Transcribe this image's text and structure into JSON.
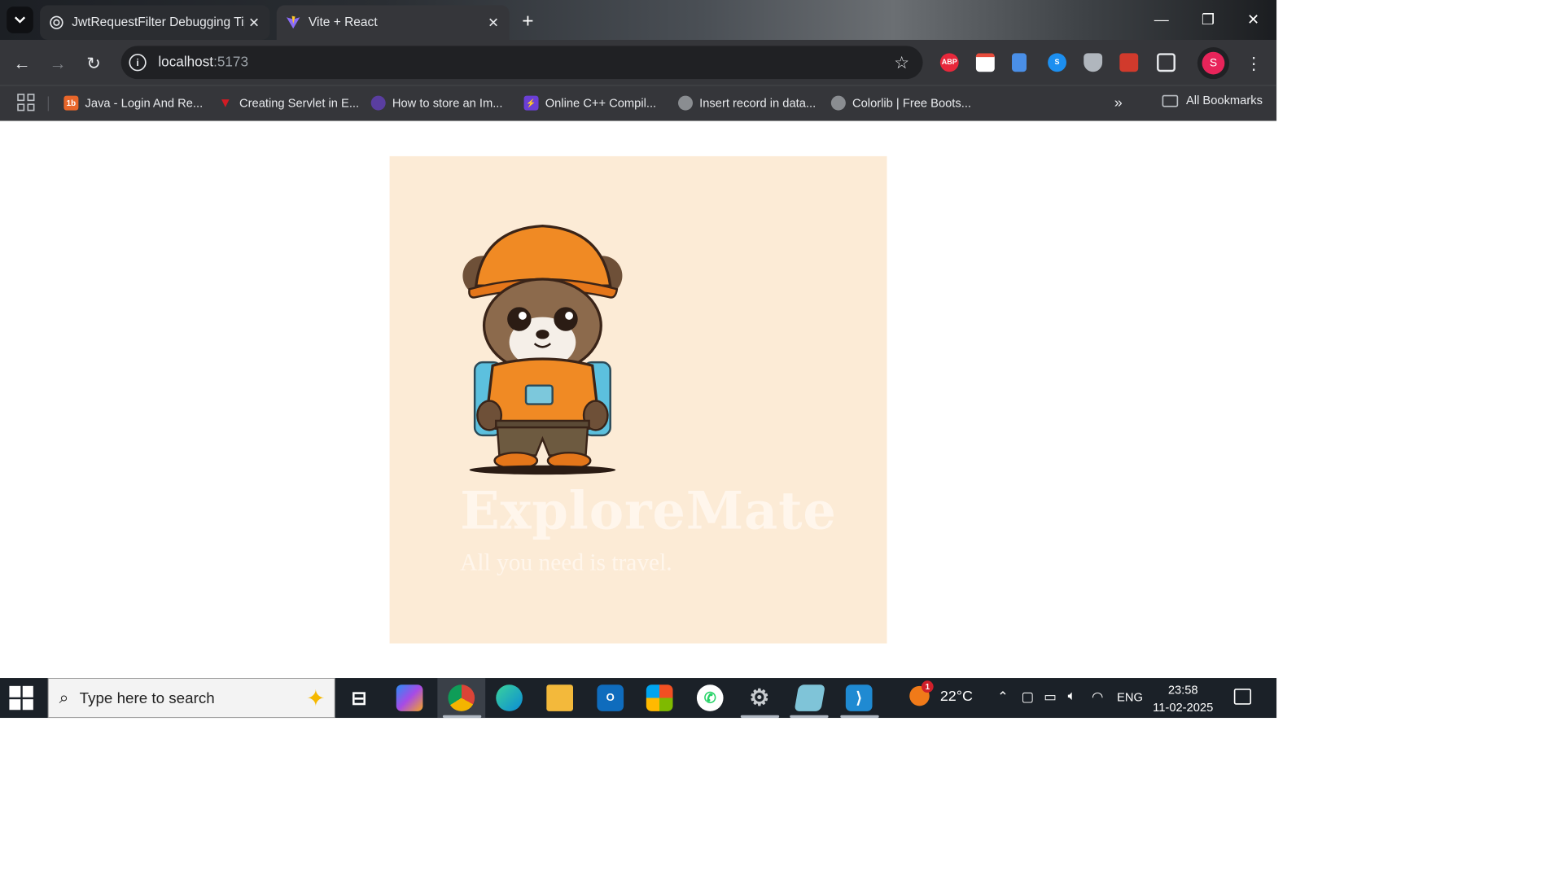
{
  "tabs": [
    {
      "title": "JwtRequestFilter Debugging Tip",
      "icon": "openai-icon",
      "active": false
    },
    {
      "title": "Vite + React",
      "icon": "vite-icon",
      "active": true
    }
  ],
  "address_bar": {
    "host": "localhost",
    "port": ":5173"
  },
  "extensions": [
    {
      "name": "adblock-plus-icon",
      "label": "ABP",
      "color": "#e8283b"
    },
    {
      "name": "calendar-icon",
      "label": "",
      "color": "#ffffff"
    },
    {
      "name": "docs-icon",
      "label": "",
      "color": "#4a8fe7"
    },
    {
      "name": "shazam-icon",
      "label": "",
      "color": "#1c8ff0"
    },
    {
      "name": "shield-icon",
      "label": "",
      "color": "#b0b6bd"
    },
    {
      "name": "puzzle-red-icon",
      "label": "",
      "color": "#d13a2c"
    }
  ],
  "profile_initial": "S",
  "bookmarks": [
    {
      "label": "Java - Login And Re...",
      "icon": "1b",
      "color": "#e8662a"
    },
    {
      "label": "Creating Servlet in E...",
      "icon": "V",
      "color": "#d11b24"
    },
    {
      "label": "How to store an Im...",
      "icon": "",
      "color": "#5a3ea0"
    },
    {
      "label": "Online C++ Compil...",
      "icon": "⚡",
      "color": "#6b3fd6"
    },
    {
      "label": "Insert record in data...",
      "icon": "",
      "color": "#8a8d91"
    },
    {
      "label": "Colorlib | Free Boots...",
      "icon": "",
      "color": "#8a8d91"
    }
  ],
  "all_bookmarks_label": "All Bookmarks",
  "page": {
    "brand_name": "ExploreMate",
    "tagline": "All you need is travel.",
    "background": "#fcebd6"
  },
  "taskbar": {
    "search_placeholder": "Type here to search",
    "apps": [
      {
        "name": "task-view-icon",
        "color": "transparent",
        "glyph": "⊟"
      },
      {
        "name": "copilot-icon",
        "color": "#7a5ce6",
        "glyph": ""
      },
      {
        "name": "chrome-icon",
        "color": "#db4437",
        "glyph": ""
      },
      {
        "name": "edge-icon",
        "color": "#0b8bd6",
        "glyph": ""
      },
      {
        "name": "file-explorer-icon",
        "color": "#f3b93b",
        "glyph": ""
      },
      {
        "name": "outlook-icon",
        "color": "#0f6cbd",
        "glyph": "O"
      },
      {
        "name": "store-icon",
        "color": "#2a7ad8",
        "glyph": ""
      },
      {
        "name": "whatsapp-icon",
        "color": "#25d366",
        "glyph": ""
      },
      {
        "name": "settings-gear-icon",
        "color": "#6a6e73",
        "glyph": "⚙"
      },
      {
        "name": "notepad-icon",
        "color": "#7fc4d8",
        "glyph": ""
      },
      {
        "name": "vscode-icon",
        "color": "#1f8ad2",
        "glyph": "⟩"
      }
    ],
    "weather": {
      "temp": "22°C",
      "badge": "1"
    },
    "language": "ENG",
    "time": "23:58",
    "date": "11-02-2025"
  }
}
